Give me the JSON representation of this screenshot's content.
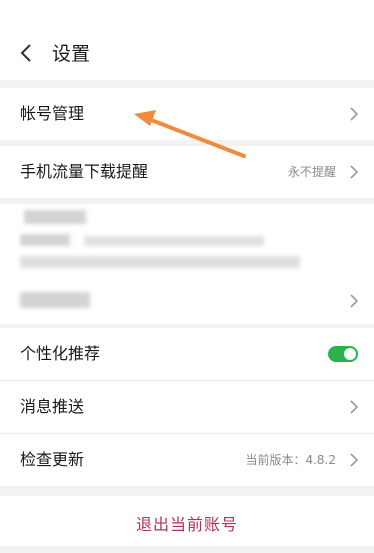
{
  "header": {
    "title": "设置"
  },
  "rows": {
    "account": {
      "label": "帐号管理"
    },
    "traffic": {
      "label": "手机流量下载提醒",
      "value": "永不提醒"
    },
    "personalized": {
      "label": "个性化推荐",
      "enabled": true
    },
    "push": {
      "label": "消息推送"
    },
    "update": {
      "label": "检查更新",
      "value": "当前版本：4.8.2"
    }
  },
  "logout": {
    "label": "退出当前账号"
  },
  "colors": {
    "toggle_on": "#2bb24c",
    "logout_text": "#b5305c",
    "annotation_arrow": "#f08a3c"
  },
  "icons": {
    "back": "chevron-left-icon",
    "row_arrow": "chevron-right-icon"
  }
}
